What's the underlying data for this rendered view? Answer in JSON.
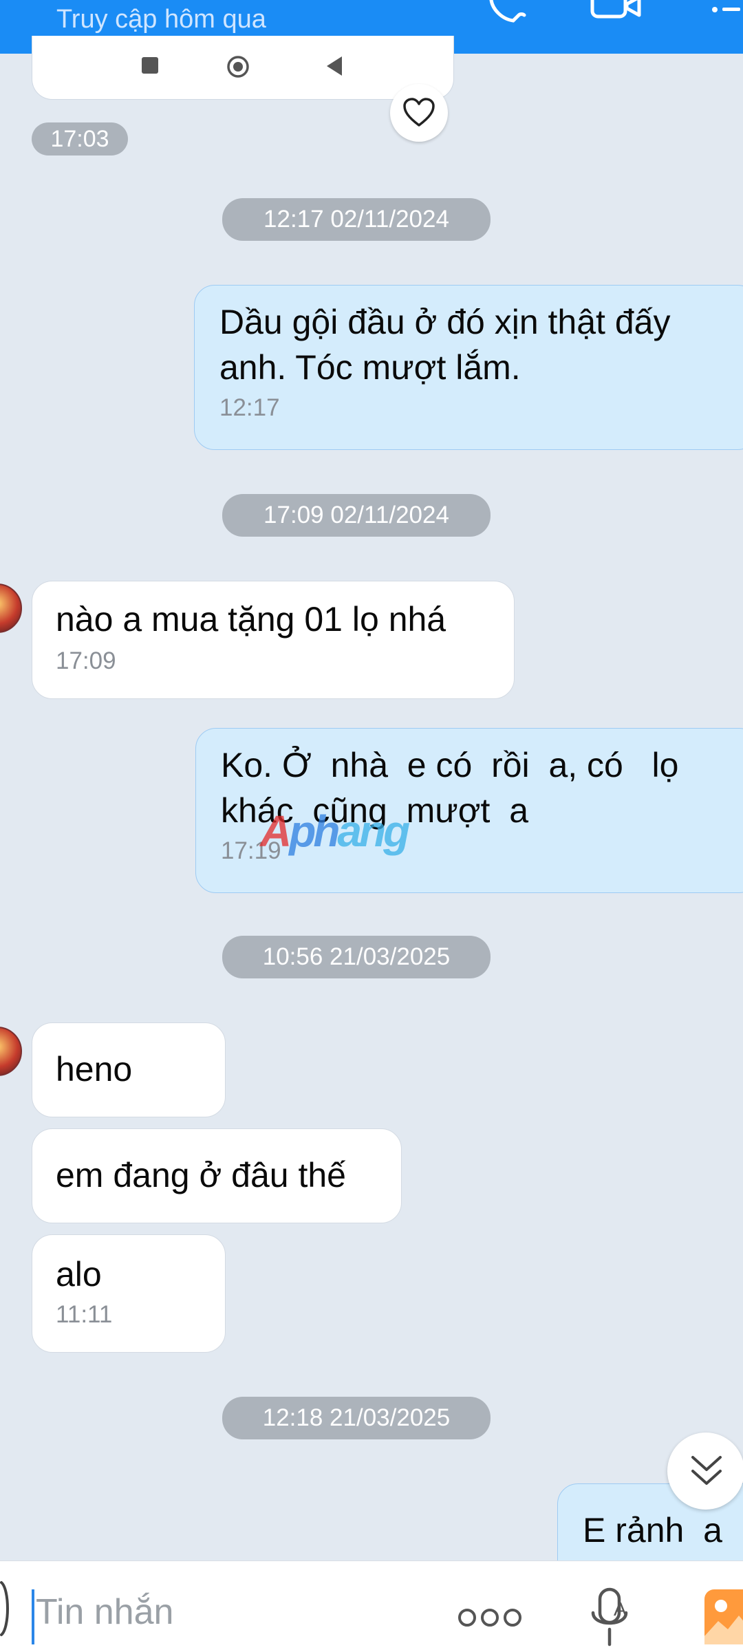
{
  "header": {
    "status_text": "Truy cập hôm qua",
    "icons": [
      "phone-icon",
      "video-call-icon",
      "more-icon"
    ]
  },
  "chat": {
    "prev_time": "17:03",
    "separators": [
      "12:17 02/11/2024",
      "17:09 02/11/2024",
      "10:56 21/03/2025",
      "12:18 21/03/2025"
    ],
    "messages": [
      {
        "sender": "me",
        "lines": [
          "Dầu gội đầu ở đó xịn thật đấy",
          "anh. Tóc mượt lắm."
        ],
        "time": "12:17"
      },
      {
        "sender": "them",
        "lines": [
          "nào a mua tặng 01 lọ nhá"
        ],
        "time": "17:09"
      },
      {
        "sender": "me",
        "lines": [
          "Ko. Ở  nhà  e có  rồi  a, có   lọ",
          "khác  cũng  mượt  a"
        ],
        "time": "17:19"
      },
      {
        "sender": "them",
        "lines": [
          "heno"
        ]
      },
      {
        "sender": "them",
        "lines": [
          "em đang ở đâu thế"
        ]
      },
      {
        "sender": "them",
        "lines": [
          "alo"
        ],
        "time": "11:11"
      },
      {
        "sender": "me",
        "lines": [
          "E rảnh  a"
        ]
      }
    ],
    "watermark": {
      "part1": "A",
      "part2": "ph",
      "part3": "ang"
    }
  },
  "input": {
    "placeholder": "Tin nhắn",
    "icons": [
      "more-options-icon",
      "voice-input-icon",
      "image-picker-icon"
    ]
  },
  "colors": {
    "header": "#1a8cf5",
    "background": "#e2e9f1",
    "my_bubble": "#d4ecfc",
    "their_bubble": "#ffffff",
    "separator_pill": "#acb3bb"
  }
}
